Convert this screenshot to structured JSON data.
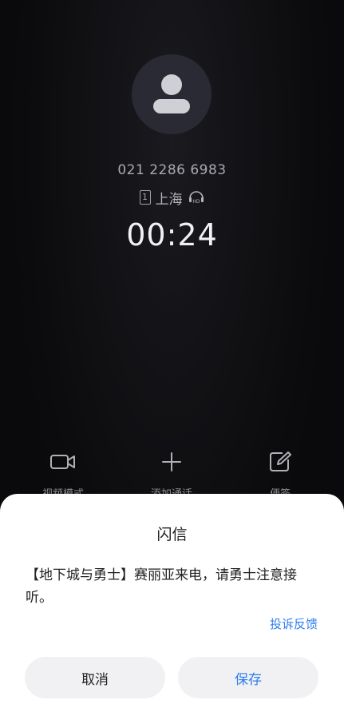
{
  "call": {
    "phone_number": "021 2286 6983",
    "sim_slot": "1",
    "location": "上海",
    "timer": "00:24",
    "avatar_icon": "person-icon",
    "hd_icon": "hd-voice-icon"
  },
  "actions": [
    {
      "label": "视频模式",
      "icon": "video-camera-icon"
    },
    {
      "label": "添加通话",
      "icon": "plus-icon"
    },
    {
      "label": "便签",
      "icon": "note-edit-icon"
    }
  ],
  "sheet": {
    "title": "闪信",
    "message": "【地下城与勇士】赛丽亚来电，请勇士注意接听。",
    "report_link": "投诉反馈",
    "cancel_label": "取消",
    "save_label": "保存"
  },
  "colors": {
    "accent": "#2f7df0",
    "background": "#0b0b0d",
    "sheet": "#ffffff"
  }
}
